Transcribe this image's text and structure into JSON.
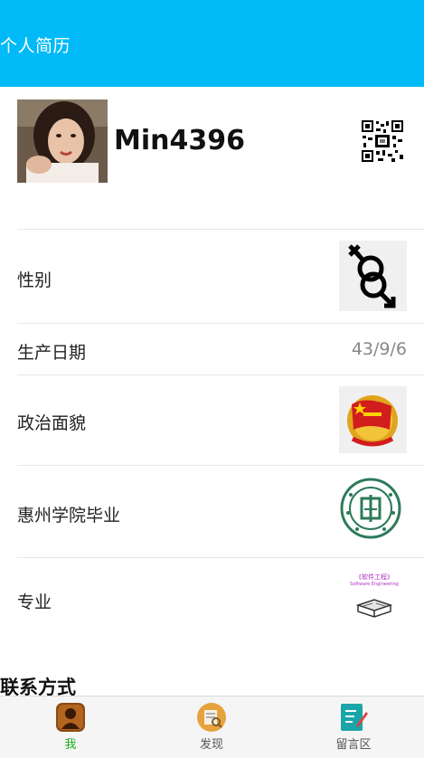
{
  "header": {
    "title": "个人简历"
  },
  "profile": {
    "username": "Min4396",
    "qr_code_icon": "qr-code"
  },
  "rows": [
    {
      "label": "性别",
      "image": "gender-symbol"
    },
    {
      "label": "生产日期",
      "value": "43/9/6"
    },
    {
      "label": "政治面貌",
      "image": "communist-youth-league-badge"
    },
    {
      "label": "惠州学院毕业",
      "image": "huizhou-university-logo"
    },
    {
      "label": "专业",
      "image": "software-engineering-book",
      "image_text": [
        "《软件工程》",
        "Software Engineering"
      ]
    }
  ],
  "contact": {
    "title": "联系方式"
  },
  "tabbar": {
    "items": [
      {
        "label": "我",
        "icon": "user-icon",
        "active": true
      },
      {
        "label": "发现",
        "icon": "discover-icon",
        "active": false
      },
      {
        "label": "留言区",
        "icon": "message-board-icon",
        "active": false
      }
    ]
  },
  "colors": {
    "header_bg": "#00baf7",
    "active_tab": "#1aad19"
  }
}
